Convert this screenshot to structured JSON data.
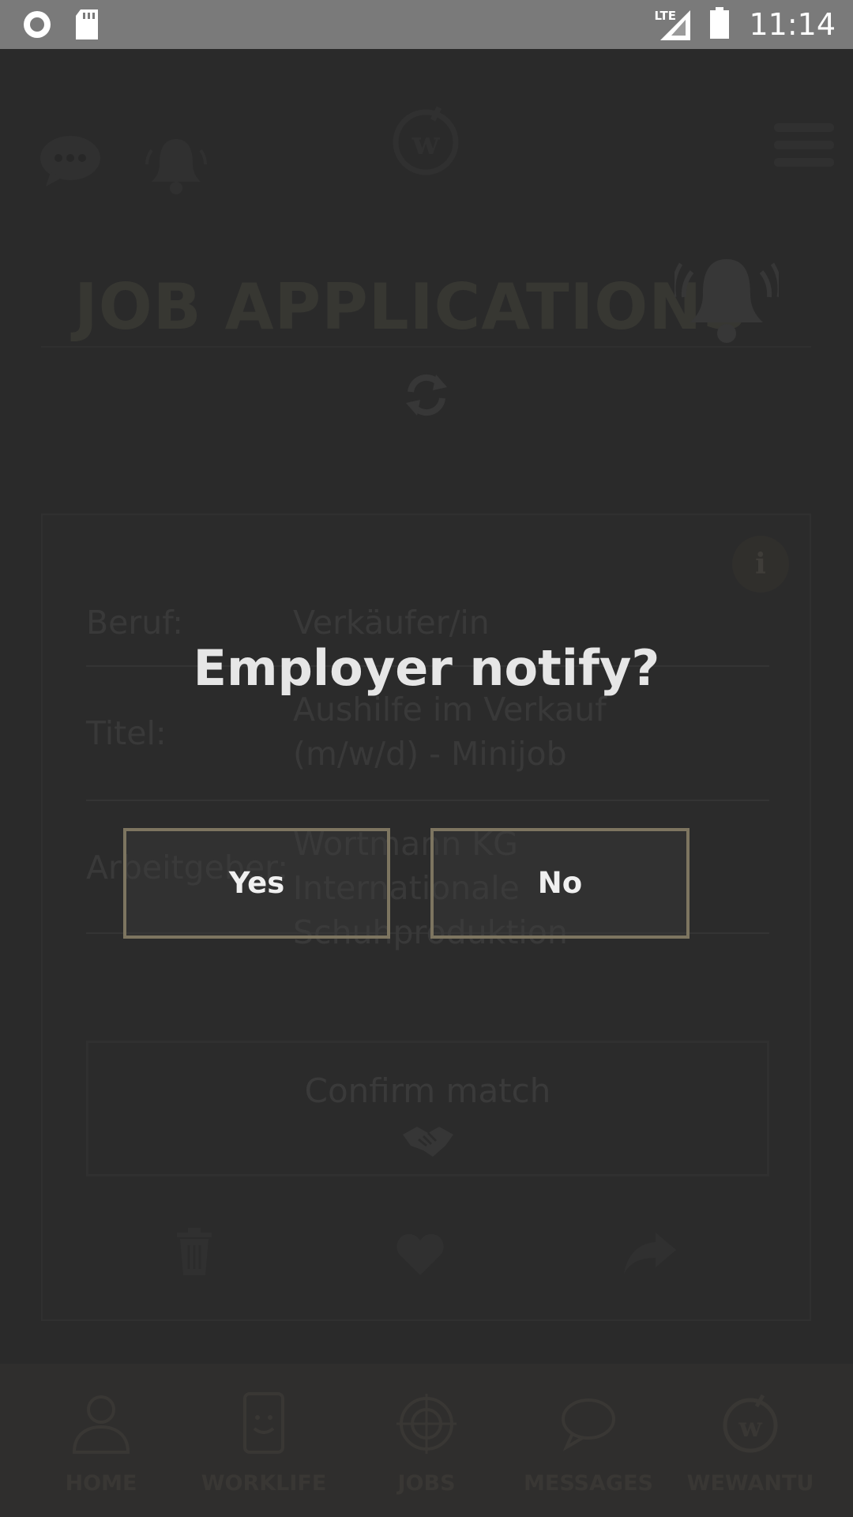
{
  "status_bar": {
    "time": "11:14",
    "network": "LTE",
    "icons": [
      "record-icon",
      "sd-card-icon",
      "signal-icon",
      "battery-icon"
    ]
  },
  "top_bar": {
    "icons": [
      "chat-icon",
      "notification-bell-icon",
      "wewantu-logo",
      "menu-icon"
    ]
  },
  "page": {
    "title": "JOB APPLICATIONS"
  },
  "job_card": {
    "rows": [
      {
        "label": "Beruf:",
        "value": "Verkäufer/in"
      },
      {
        "label": "Titel:",
        "value": "Aushilfe im Verkauf (m/w/d) - Minijob"
      },
      {
        "label": "Arbeitgeber:",
        "value": "Wortmann KG Internationale Schuhproduktion"
      }
    ],
    "confirm_label": "Confirm match",
    "info_label": "i",
    "actions": [
      "trash-icon",
      "heart-icon",
      "share-icon"
    ]
  },
  "bottom_nav": {
    "items": [
      {
        "label": "HOME",
        "icon": "person-icon"
      },
      {
        "label": "WORKLIFE",
        "icon": "smiley-phone-icon"
      },
      {
        "label": "JOBS",
        "icon": "target-icon"
      },
      {
        "label": "MESSAGES",
        "icon": "speech-bubble-icon"
      },
      {
        "label": "WEWANTU",
        "icon": "wewantu-logo"
      }
    ]
  },
  "dialog": {
    "title": "Employer notify?",
    "yes_label": "Yes",
    "no_label": "No"
  },
  "colors": {
    "accent_border": "#7d7560",
    "status_bar": "#7a7a7a",
    "overlay_text": "#e6e6e6"
  }
}
